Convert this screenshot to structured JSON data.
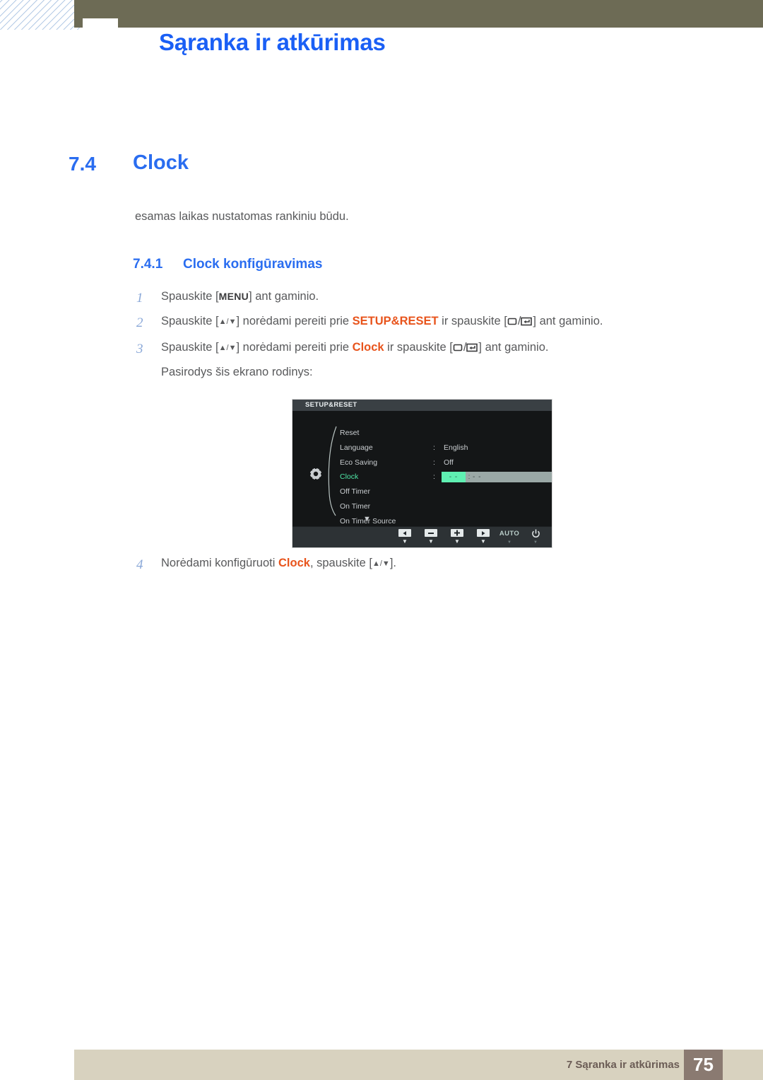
{
  "header": {
    "title": "Sąranka ir atkūrimas"
  },
  "section": {
    "number": "7.4",
    "title": "Clock",
    "intro": "esamas laikas nustatomas rankiniu būdu."
  },
  "subsection": {
    "number": "7.4.1",
    "title": "Clock konfigūravimas"
  },
  "steps": [
    {
      "num": "1",
      "part1": "Spauskite [",
      "key": "MENU",
      "part2": "] ant gaminio.",
      "highlight": "",
      "part3": "",
      "part4": ""
    },
    {
      "num": "2",
      "part1": "Spauskite [",
      "arrows": "▲/▼",
      "part2": "] norėdami pereiti prie ",
      "highlight": "SETUP&RESET",
      "part3": " ir spauskite [",
      "part4": "] ant gaminio."
    },
    {
      "num": "3",
      "part1": "Spauskite [",
      "arrows": "▲/▼",
      "part2": "] norėdami pereiti prie ",
      "highlight": "Clock",
      "part3": " ir spauskite [",
      "part4": "] ant gaminio.",
      "subline": "Pasirodys šis ekrano rodinys:"
    },
    {
      "num": "4",
      "part1": "Norėdami konfigūruoti ",
      "highlight": "Clock",
      "part2": ", spauskite [",
      "arrows": "▲/▼",
      "part3": "]."
    }
  ],
  "osd": {
    "title": "SETUP&RESET",
    "rows": [
      {
        "label": "Reset",
        "colon": "",
        "value": "",
        "active": false
      },
      {
        "label": "Language",
        "colon": ":",
        "value": "English",
        "active": false
      },
      {
        "label": "Eco Saving",
        "colon": ":",
        "value": "Off",
        "active": false
      },
      {
        "label": "Clock",
        "colon": ":",
        "value": "",
        "active": true
      },
      {
        "label": "Off Timer",
        "colon": "",
        "value": "",
        "active": false
      },
      {
        "label": "On Timer",
        "colon": "",
        "value": "",
        "active": false
      },
      {
        "label": "On Timer Source",
        "colon": "",
        "value": "",
        "active": false
      }
    ],
    "clock_field": {
      "hours": "- -",
      "separator": ":",
      "minutes": "- -"
    },
    "scroll_more": "▼",
    "buttons": [
      {
        "name": "left",
        "glyph": "◀",
        "caret": "▼",
        "dim": false
      },
      {
        "name": "minus",
        "glyph": "▬",
        "caret": "▼",
        "dim": false
      },
      {
        "name": "plus",
        "glyph": "✛",
        "caret": "▼",
        "dim": false
      },
      {
        "name": "right",
        "glyph": "▶",
        "caret": "▼",
        "dim": false
      },
      {
        "name": "auto",
        "glyph": "AUTO",
        "caret": "▼",
        "dim": true
      },
      {
        "name": "power",
        "glyph": "⏻",
        "caret": "▼",
        "dim": true
      }
    ]
  },
  "footer": {
    "text": "7 Sąranka ir atkūrimas",
    "page": "75"
  },
  "colors": {
    "accent_blue": "#2a6df0",
    "accent_orange": "#e8541c",
    "olive": "#6d6b55",
    "footer_bg": "#d8d2bf",
    "footer_page_bg": "#8a7a71",
    "osd_highlight_green": "#4fe6a6"
  }
}
